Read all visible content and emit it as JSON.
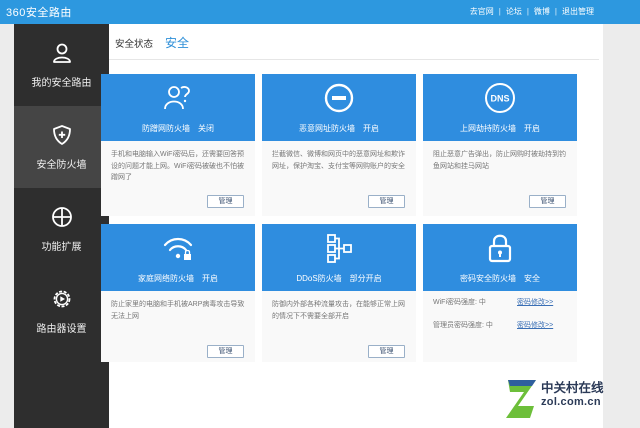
{
  "header": {
    "logo": "360安全路由",
    "links": [
      "去官网",
      "论坛",
      "微博",
      "退出管理"
    ]
  },
  "sidebar": {
    "items": [
      {
        "label": "我的安全路由",
        "icon": "user-icon",
        "active": false
      },
      {
        "label": "安全防火墙",
        "icon": "shield-plus-icon",
        "active": true
      },
      {
        "label": "功能扩展",
        "icon": "grid-circle-icon",
        "active": false
      },
      {
        "label": "路由器设置",
        "icon": "gear-play-icon",
        "active": false
      }
    ]
  },
  "main": {
    "tabs": [
      "安全状态",
      "安全"
    ],
    "cards": [
      {
        "title": "防蹭网防火墙",
        "status": "关闭",
        "icon": "users-question-icon",
        "desc": "手机和电脑输入WiFi密码后，还需要回答预设的问题才能上网。WiFi密码被破也不怕被蹭网了",
        "button": "管理"
      },
      {
        "title": "恶意网址防火墙",
        "status": "开启",
        "icon": "minus-circle-icon",
        "desc": "拦截微信、微博和网页中的恶意网址和欺诈网址，保护淘宝、支付宝等网购账户的安全",
        "button": "管理"
      },
      {
        "title": "上网劫持防火墙",
        "status": "开启",
        "icon": "dns-icon",
        "desc": "阻止恶意广告弹出，防止网购时被劫持到钓鱼网站和挂马网站",
        "button": "管理"
      },
      {
        "title": "家庭网络防火墙",
        "status": "开启",
        "icon": "wifi-lock-icon",
        "desc": "防止家里的电脑和手机被ARP病毒攻击导致无法上网",
        "button": "管理"
      },
      {
        "title": "DDoS防火墙",
        "status": "部分开启",
        "icon": "network-tree-icon",
        "desc": "防御内外部各种流量攻击，在能够正常上网的情况下不需要全部开启",
        "button": "管理"
      },
      {
        "title": "密码安全防火墙",
        "status": "安全",
        "icon": "lock-icon",
        "rows": [
          {
            "label": "WiFi密码强度: 中",
            "link": "密码修改>>"
          },
          {
            "label": "管理员密码强度: 中",
            "link": "密码修改>>"
          }
        ]
      }
    ]
  },
  "watermark": {
    "line1": "中关村在线",
    "line2": "zol.com.cn",
    "icon": "zol-logo-icon"
  }
}
